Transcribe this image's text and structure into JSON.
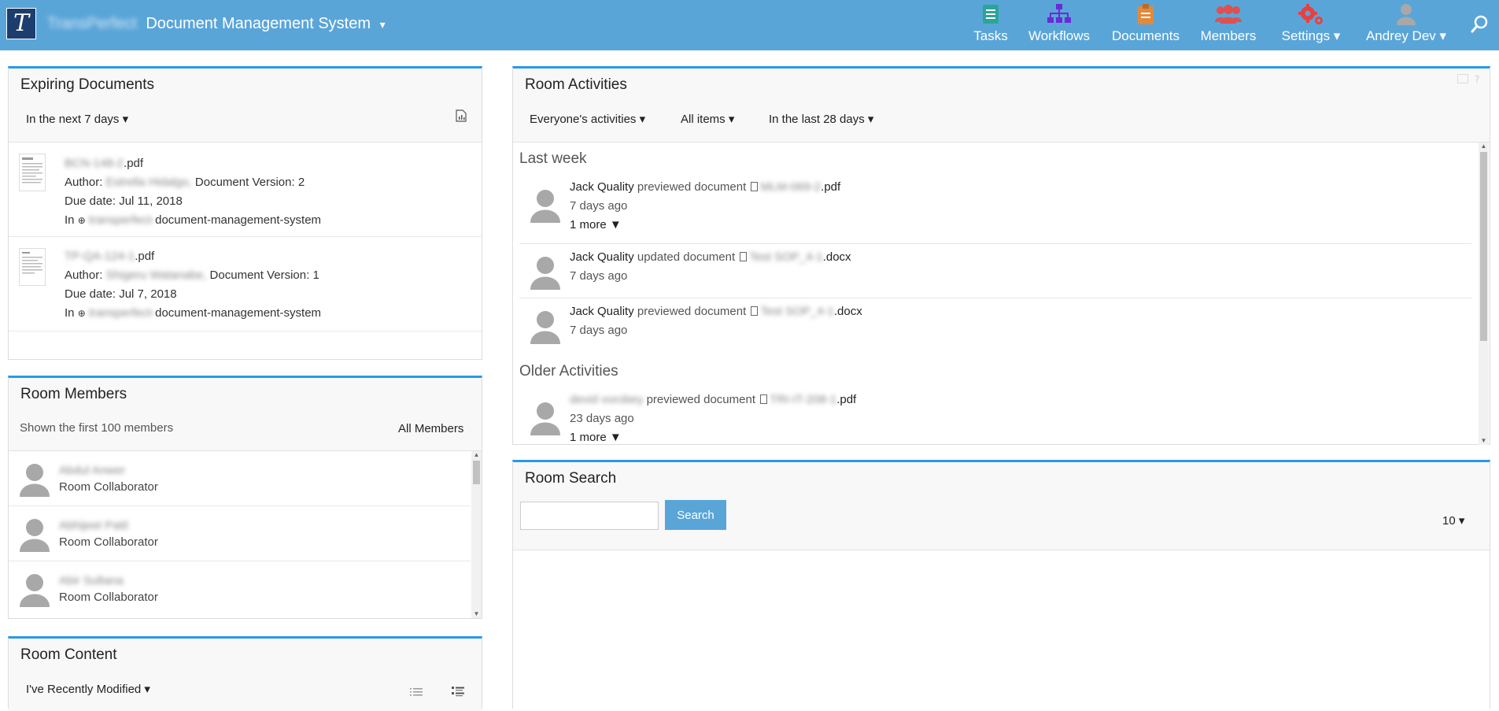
{
  "header": {
    "brand_blurred": "TransPerfect",
    "brand_title": "Document Management System",
    "brand_caret": "▾",
    "nav": [
      {
        "label": "Tasks",
        "icon": "tasks-icon"
      },
      {
        "label": "Workflows",
        "icon": "workflows-icon"
      },
      {
        "label": "Documents",
        "icon": "documents-icon"
      },
      {
        "label": "Members",
        "icon": "members-icon"
      },
      {
        "label": "Settings ▾",
        "icon": "settings-icon"
      },
      {
        "label": "Andrey Dev ▾",
        "icon": "user-icon"
      }
    ],
    "colors": {
      "bar": "#5aa5d8",
      "tasks": "#2aa59a",
      "workflows": "#6a2bd6",
      "documents": "#e08a3c",
      "members": "#e05050",
      "settings": "#e84040",
      "user": "#a8a8a8"
    }
  },
  "expiring": {
    "title": "Expiring Documents",
    "filter": "In the next 7 days ▾",
    "docs": [
      {
        "name_blur": "BCN-148-2",
        "ext": ".pdf",
        "author_label": "Author: ",
        "author_blur": "Estrella Hidalgo,",
        "version": " Document Version: 2",
        "due": "Due date: Jul 11, 2018",
        "in_label": "In ",
        "room_blur": "transperfect-",
        "room": "document-management-system"
      },
      {
        "name_blur": "TP-QA-124-1",
        "ext": ".pdf",
        "author_label": "Author: ",
        "author_blur": "Shigeru Watanabe,",
        "version": " Document Version: 1",
        "due": "Due date: Jul 7, 2018",
        "in_label": "In ",
        "room_blur": "transperfect-",
        "room": "document-management-system"
      }
    ]
  },
  "members": {
    "title": "Room Members",
    "shown": "Shown the first 100 members",
    "all_link": "All Members",
    "list": [
      {
        "name": "Abdul Anwer",
        "role": "Room Collaborator"
      },
      {
        "name": "Abhijeet Patil",
        "role": "Room Collaborator"
      },
      {
        "name": "Abir Sultana",
        "role": "Room Collaborator"
      }
    ]
  },
  "content": {
    "title": "Room Content",
    "filter": "I've Recently Modified ▾"
  },
  "activities": {
    "title": "Room Activities",
    "filters": [
      "Everyone's activities ▾",
      "All items ▾",
      "In the last 28 days ▾"
    ],
    "groups": {
      "last_week": "Last week",
      "older": "Older Activities"
    },
    "items": [
      {
        "user": "Jack Quality",
        "action": " previewed document ",
        "file_blur": "MLM-069-2",
        "ext": ".pdf",
        "time": "7 days ago",
        "more": "1 more ▼"
      },
      {
        "user": "Jack Quality",
        "action": " updated document ",
        "file_blur": "Test SOP_4-1",
        "ext": ".docx",
        "time": "7 days ago"
      },
      {
        "user": "Jack Quality",
        "action": " previewed document ",
        "file_blur": "Test SOP_4-1",
        "ext": ".docx",
        "time": "7 days ago"
      },
      {
        "user": "devid vorobey",
        "action": " previewed document ",
        "file_blur": "TRI-IT-208-1",
        "ext": ".pdf",
        "time": "23 days ago",
        "more": "1 more ▼"
      }
    ]
  },
  "search": {
    "title": "Room Search",
    "button": "Search",
    "placeholder": "",
    "page_size": "10 ▾"
  }
}
